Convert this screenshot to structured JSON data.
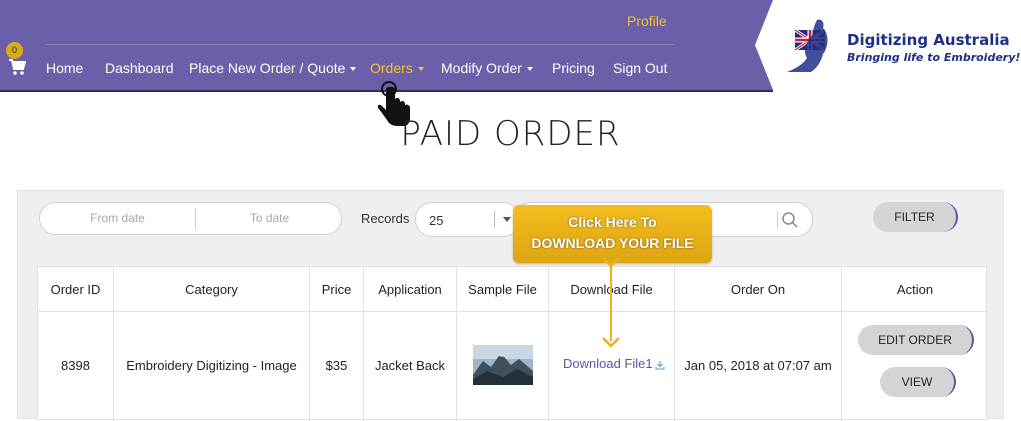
{
  "header": {
    "profile_label": "Profile",
    "cart_count": "0",
    "nav": [
      {
        "label": "Home",
        "dropdown": false
      },
      {
        "label": "Dashboard",
        "dropdown": false
      },
      {
        "label": "Place New Order / Quote",
        "dropdown": true
      },
      {
        "label": "Orders",
        "dropdown": true,
        "active": true
      },
      {
        "label": "Modify Order",
        "dropdown": true
      },
      {
        "label": "Pricing",
        "dropdown": false
      },
      {
        "label": "Sign Out",
        "dropdown": false
      }
    ],
    "logo": {
      "line1": "Digitizing Australia",
      "line2": "Bringing life to Embroidery!"
    },
    "colors": {
      "navbar": "#6a5fa8",
      "accent": "#f5c12e"
    }
  },
  "page": {
    "title": "PAID ORDER"
  },
  "filters": {
    "from_date_placeholder": "From date",
    "to_date_placeholder": "To date",
    "records_label": "Records",
    "records_value": "25",
    "filter_button": "FILTER"
  },
  "table": {
    "headers": [
      "Order ID",
      "Category",
      "Price",
      "Application",
      "Sample File",
      "Download File",
      "Order On",
      "Action"
    ],
    "rows": [
      {
        "order_id": "8398",
        "category": "Embroidery Digitizing - Image",
        "price": "$35",
        "application": "Jacket Back",
        "sample_file": "mountain-landscape-thumbnail",
        "download_label": "Download File1",
        "order_on": "Jan 05, 2018 at 07:07 am",
        "actions": [
          "EDIT ORDER",
          "VIEW"
        ]
      }
    ]
  },
  "callout": {
    "line1": "Click Here To",
    "line2": "DOWNLOAD YOUR FILE"
  }
}
